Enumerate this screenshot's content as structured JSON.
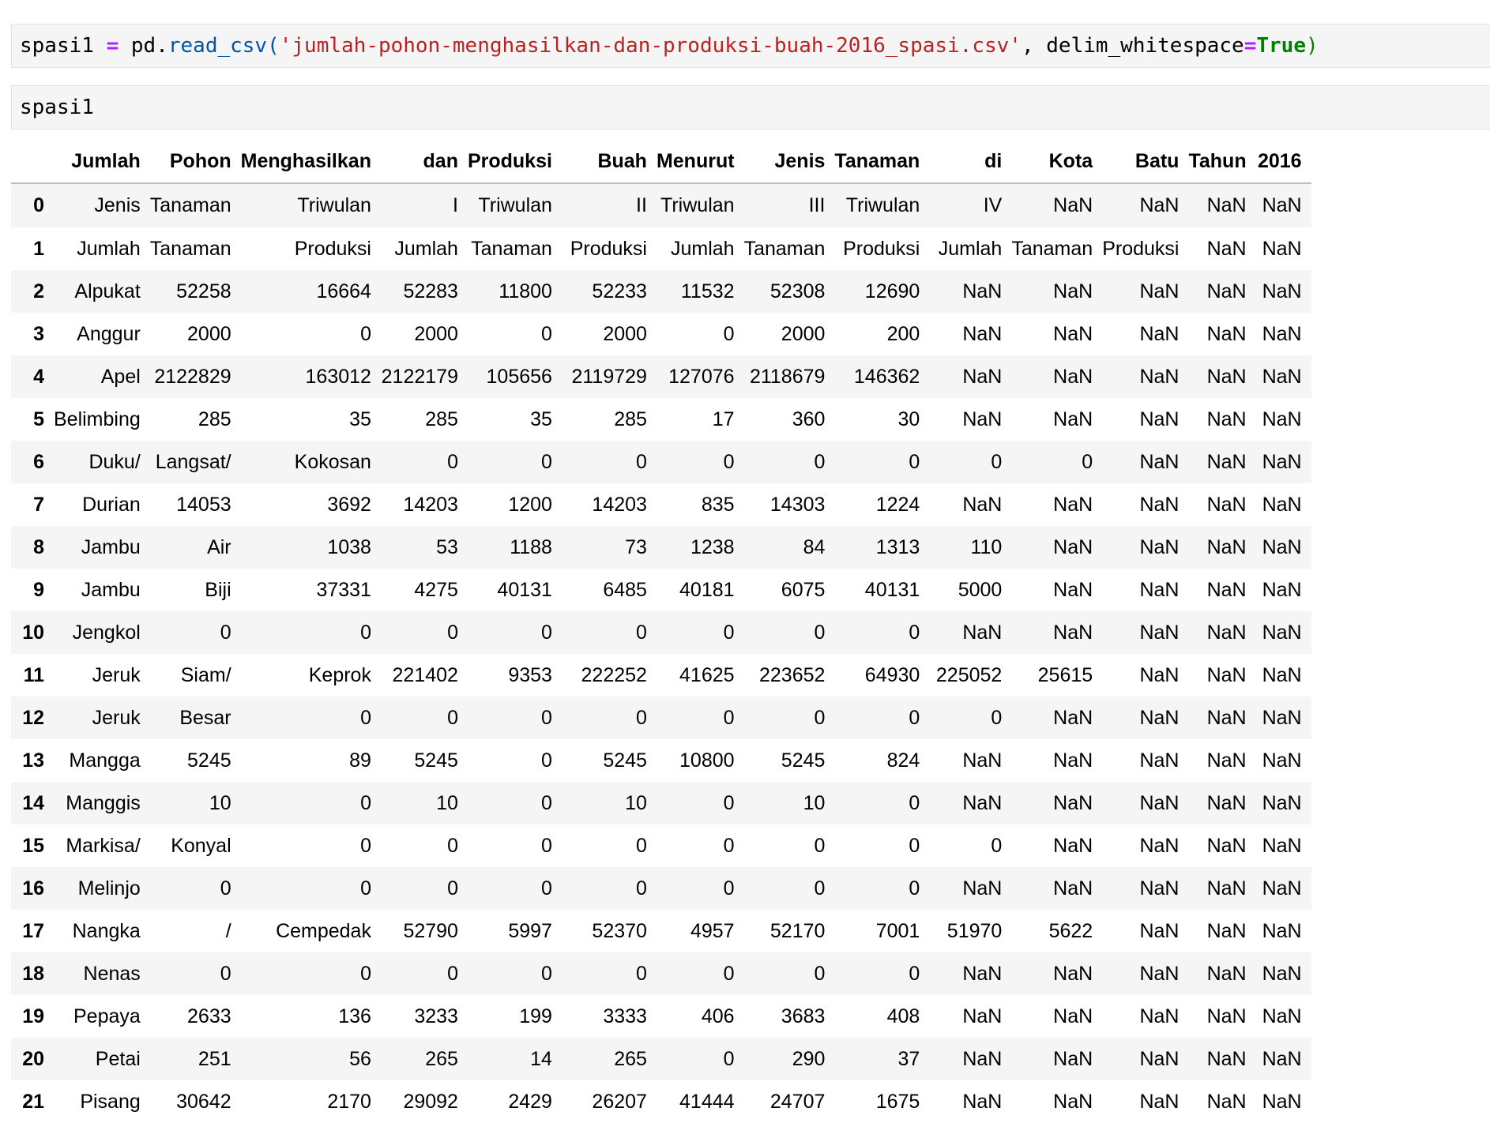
{
  "cell1": {
    "var": "spasi1",
    "eq": " = ",
    "mod": "pd.",
    "func": "read_csv",
    "open": "(",
    "str": "'jumlah-pohon-menghasilkan-dan-produksi-buah-2016_spasi.csv'",
    "comma": ", delim_whitespace",
    "eq2": "=",
    "kw": "True",
    "close": ")"
  },
  "cell2": {
    "code": "spasi1"
  },
  "table": {
    "columns": [
      "",
      "Jumlah",
      "Pohon",
      "Menghasilkan",
      "dan",
      "Produksi",
      "Buah",
      "Menurut",
      "Jenis",
      "Tanaman",
      "di",
      "Kota",
      "Batu",
      "Tahun",
      "2016"
    ],
    "rows": [
      [
        "0",
        "Jenis",
        "Tanaman",
        "Triwulan",
        "I",
        "Triwulan",
        "II",
        "Triwulan",
        "III",
        "Triwulan",
        "IV",
        "NaN",
        "NaN",
        "NaN",
        "NaN"
      ],
      [
        "1",
        "Jumlah",
        "Tanaman",
        "Produksi",
        "Jumlah",
        "Tanaman",
        "Produksi",
        "Jumlah",
        "Tanaman",
        "Produksi",
        "Jumlah",
        "Tanaman",
        "Produksi",
        "NaN",
        "NaN"
      ],
      [
        "2",
        "Alpukat",
        "52258",
        "16664",
        "52283",
        "11800",
        "52233",
        "11532",
        "52308",
        "12690",
        "NaN",
        "NaN",
        "NaN",
        "NaN",
        "NaN"
      ],
      [
        "3",
        "Anggur",
        "2000",
        "0",
        "2000",
        "0",
        "2000",
        "0",
        "2000",
        "200",
        "NaN",
        "NaN",
        "NaN",
        "NaN",
        "NaN"
      ],
      [
        "4",
        "Apel",
        "2122829",
        "163012",
        "2122179",
        "105656",
        "2119729",
        "127076",
        "2118679",
        "146362",
        "NaN",
        "NaN",
        "NaN",
        "NaN",
        "NaN"
      ],
      [
        "5",
        "Belimbing",
        "285",
        "35",
        "285",
        "35",
        "285",
        "17",
        "360",
        "30",
        "NaN",
        "NaN",
        "NaN",
        "NaN",
        "NaN"
      ],
      [
        "6",
        "Duku/",
        "Langsat/",
        "Kokosan",
        "0",
        "0",
        "0",
        "0",
        "0",
        "0",
        "0",
        "0",
        "NaN",
        "NaN",
        "NaN"
      ],
      [
        "7",
        "Durian",
        "14053",
        "3692",
        "14203",
        "1200",
        "14203",
        "835",
        "14303",
        "1224",
        "NaN",
        "NaN",
        "NaN",
        "NaN",
        "NaN"
      ],
      [
        "8",
        "Jambu",
        "Air",
        "1038",
        "53",
        "1188",
        "73",
        "1238",
        "84",
        "1313",
        "110",
        "NaN",
        "NaN",
        "NaN",
        "NaN"
      ],
      [
        "9",
        "Jambu",
        "Biji",
        "37331",
        "4275",
        "40131",
        "6485",
        "40181",
        "6075",
        "40131",
        "5000",
        "NaN",
        "NaN",
        "NaN",
        "NaN"
      ],
      [
        "10",
        "Jengkol",
        "0",
        "0",
        "0",
        "0",
        "0",
        "0",
        "0",
        "0",
        "NaN",
        "NaN",
        "NaN",
        "NaN",
        "NaN"
      ],
      [
        "11",
        "Jeruk",
        "Siam/",
        "Keprok",
        "221402",
        "9353",
        "222252",
        "41625",
        "223652",
        "64930",
        "225052",
        "25615",
        "NaN",
        "NaN",
        "NaN"
      ],
      [
        "12",
        "Jeruk",
        "Besar",
        "0",
        "0",
        "0",
        "0",
        "0",
        "0",
        "0",
        "0",
        "NaN",
        "NaN",
        "NaN",
        "NaN"
      ],
      [
        "13",
        "Mangga",
        "5245",
        "89",
        "5245",
        "0",
        "5245",
        "10800",
        "5245",
        "824",
        "NaN",
        "NaN",
        "NaN",
        "NaN",
        "NaN"
      ],
      [
        "14",
        "Manggis",
        "10",
        "0",
        "10",
        "0",
        "10",
        "0",
        "10",
        "0",
        "NaN",
        "NaN",
        "NaN",
        "NaN",
        "NaN"
      ],
      [
        "15",
        "Markisa/",
        "Konyal",
        "0",
        "0",
        "0",
        "0",
        "0",
        "0",
        "0",
        "0",
        "NaN",
        "NaN",
        "NaN",
        "NaN"
      ],
      [
        "16",
        "Melinjo",
        "0",
        "0",
        "0",
        "0",
        "0",
        "0",
        "0",
        "0",
        "NaN",
        "NaN",
        "NaN",
        "NaN",
        "NaN"
      ],
      [
        "17",
        "Nangka",
        "/",
        "Cempedak",
        "52790",
        "5997",
        "52370",
        "4957",
        "52170",
        "7001",
        "51970",
        "5622",
        "NaN",
        "NaN",
        "NaN"
      ],
      [
        "18",
        "Nenas",
        "0",
        "0",
        "0",
        "0",
        "0",
        "0",
        "0",
        "0",
        "NaN",
        "NaN",
        "NaN",
        "NaN",
        "NaN"
      ],
      [
        "19",
        "Pepaya",
        "2633",
        "136",
        "3233",
        "199",
        "3333",
        "406",
        "3683",
        "408",
        "NaN",
        "NaN",
        "NaN",
        "NaN",
        "NaN"
      ],
      [
        "20",
        "Petai",
        "251",
        "56",
        "265",
        "14",
        "265",
        "0",
        "290",
        "37",
        "NaN",
        "NaN",
        "NaN",
        "NaN",
        "NaN"
      ],
      [
        "21",
        "Pisang",
        "30642",
        "2170",
        "29092",
        "2429",
        "26207",
        "41444",
        "24707",
        "1675",
        "NaN",
        "NaN",
        "NaN",
        "NaN",
        "NaN"
      ]
    ]
  }
}
